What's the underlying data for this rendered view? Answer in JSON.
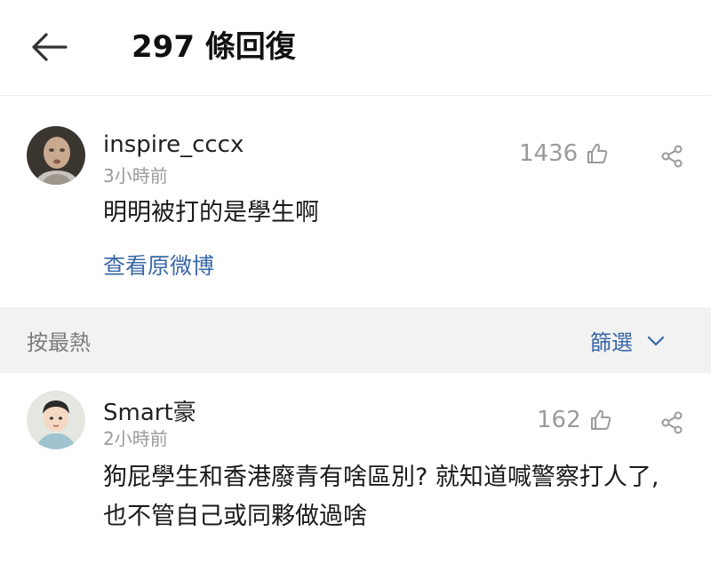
{
  "header": {
    "title": "297 條回復",
    "back_icon": "back-arrow-icon"
  },
  "comments": [
    {
      "username": "inspire_cccx",
      "timestamp": "3小時前",
      "likes": "1436",
      "text": "明明被打的是學生啊",
      "link": "查看原微博"
    },
    {
      "username": "Smart豪",
      "timestamp": "2小時前",
      "likes": "162",
      "text": "狗屁學生和香港廢青有啥區別? 就知道喊警察打人了, 也不管自己或同夥做過啥"
    }
  ],
  "sort_bar": {
    "sort_label": "按最熱",
    "filter_label": "篩選"
  },
  "colors": {
    "link": "#3a68a8",
    "muted": "#9a9a9a",
    "divider_bg": "#f2f2f2"
  }
}
